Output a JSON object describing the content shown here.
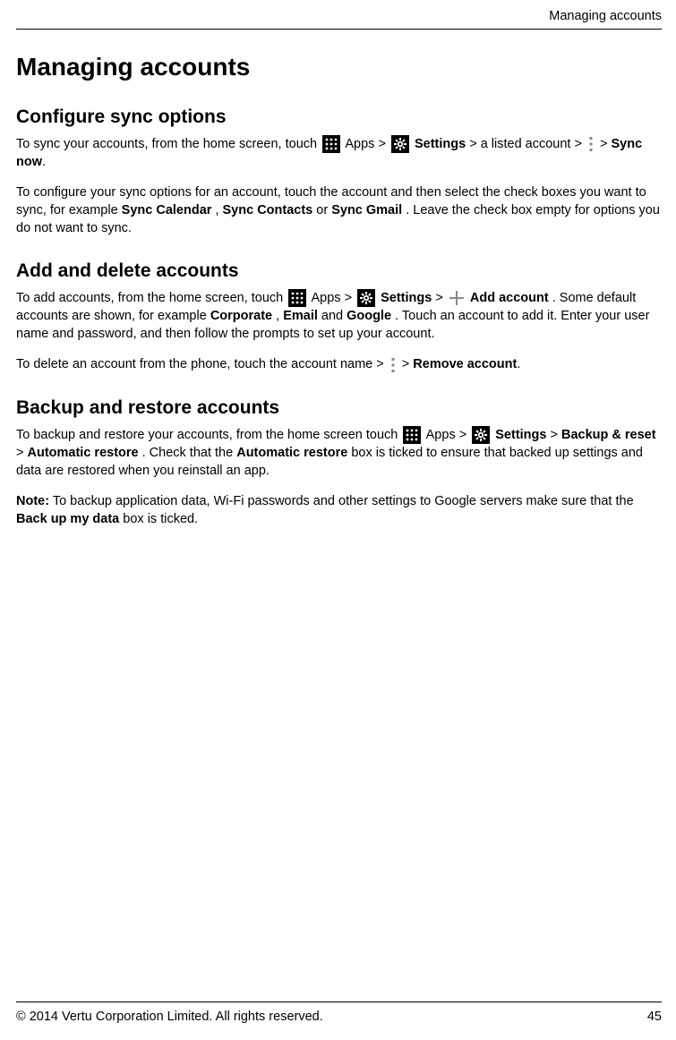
{
  "running_header": "Managing accounts",
  "page_title": "Managing accounts",
  "icons": {
    "apps": "apps-grid-icon",
    "settings": "settings-gear-icon",
    "overflow": "overflow-menu-icon",
    "plus": "plus-icon"
  },
  "labels": {
    "gt": ">",
    "apps": "Apps",
    "settings": "Settings",
    "sync_now": "Sync now",
    "sync_calendar": "Sync Calendar",
    "sync_contacts": "Sync Contacts",
    "sync_gmail": "Sync Gmail",
    "add_account": "Add account",
    "corporate": "Corporate",
    "email": "Email",
    "google": "Google",
    "remove_account": "Remove account",
    "backup_reset": "Backup & reset",
    "automatic_restore": "Automatic restore",
    "automatic_restore2": "Automatic restore",
    "note": "Note:",
    "back_up_my_data": "Back up my data"
  },
  "sections": {
    "configure": {
      "heading": "Configure sync options",
      "p1a": "To sync your accounts, from the home screen, touch ",
      "p1b": " > a listed account > ",
      "p1c": " > ",
      "p1d": ".",
      "p2a": "To configure your sync options for an account, touch the account and then select the check boxes you want to sync, for example ",
      "p2b": ", ",
      "p2c": " or ",
      "p2d": ". Leave the check box empty for options you do not want to sync."
    },
    "add_delete": {
      "heading": "Add and delete accounts",
      "p1a": "To add accounts, from the home screen, touch ",
      "p1b": " > ",
      "p1c": ". Some default accounts are shown, for example ",
      "p1d": ", ",
      "p1e": " and ",
      "p1f": ". Touch an account to add it. Enter your user name and password, and then follow the prompts to set up your account.",
      "p2a": "To delete an account from the phone, touch the account name > ",
      "p2b": " > ",
      "p2c": "."
    },
    "backup": {
      "heading": "Backup and restore accounts",
      "p1a": "To backup and restore your accounts, from the home screen touch ",
      "p1b": " > ",
      "p1c": " > ",
      "p1d": ". Check that the ",
      "p1e": " box is ticked to ensure that backed up settings and data are restored when you reinstall an app.",
      "p2a": " To backup application data, Wi-Fi passwords and other settings to Google servers make sure that the ",
      "p2b": " box is ticked."
    }
  },
  "footer": {
    "copyright": "© 2014 Vertu Corporation Limited. All rights reserved.",
    "page_number": "45"
  }
}
